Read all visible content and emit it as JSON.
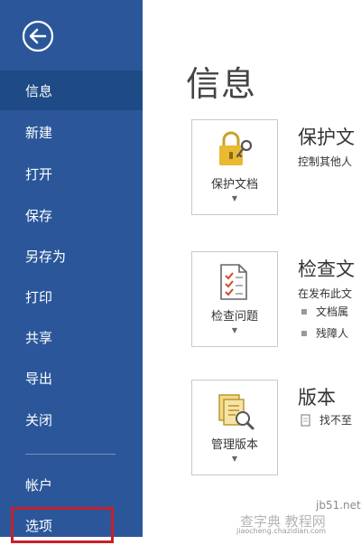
{
  "sidebar": {
    "items": [
      {
        "label": "信息"
      },
      {
        "label": "新建"
      },
      {
        "label": "打开"
      },
      {
        "label": "保存"
      },
      {
        "label": "另存为"
      },
      {
        "label": "打印"
      },
      {
        "label": "共享"
      },
      {
        "label": "导出"
      },
      {
        "label": "关闭"
      }
    ],
    "account_label": "帐户",
    "options_label": "选项"
  },
  "main": {
    "title": "信息",
    "sections": [
      {
        "tile_label": "保护文档",
        "heading": "保护文",
        "desc": "控制其他人"
      },
      {
        "tile_label": "检查问题",
        "heading": "检查文",
        "desc": "在发布此文",
        "bullets": [
          "文档属",
          "残障人"
        ]
      },
      {
        "tile_label": "管理版本",
        "heading": "版本",
        "desc": "找不至"
      }
    ]
  },
  "watermark": {
    "site": "jb51.net",
    "text": "查字典 教程网",
    "url": "jiaocheng.chazidian.com"
  },
  "colors": {
    "sidebar": "#2b579a",
    "active": "#1e4a85",
    "highlight": "#c8202a"
  }
}
